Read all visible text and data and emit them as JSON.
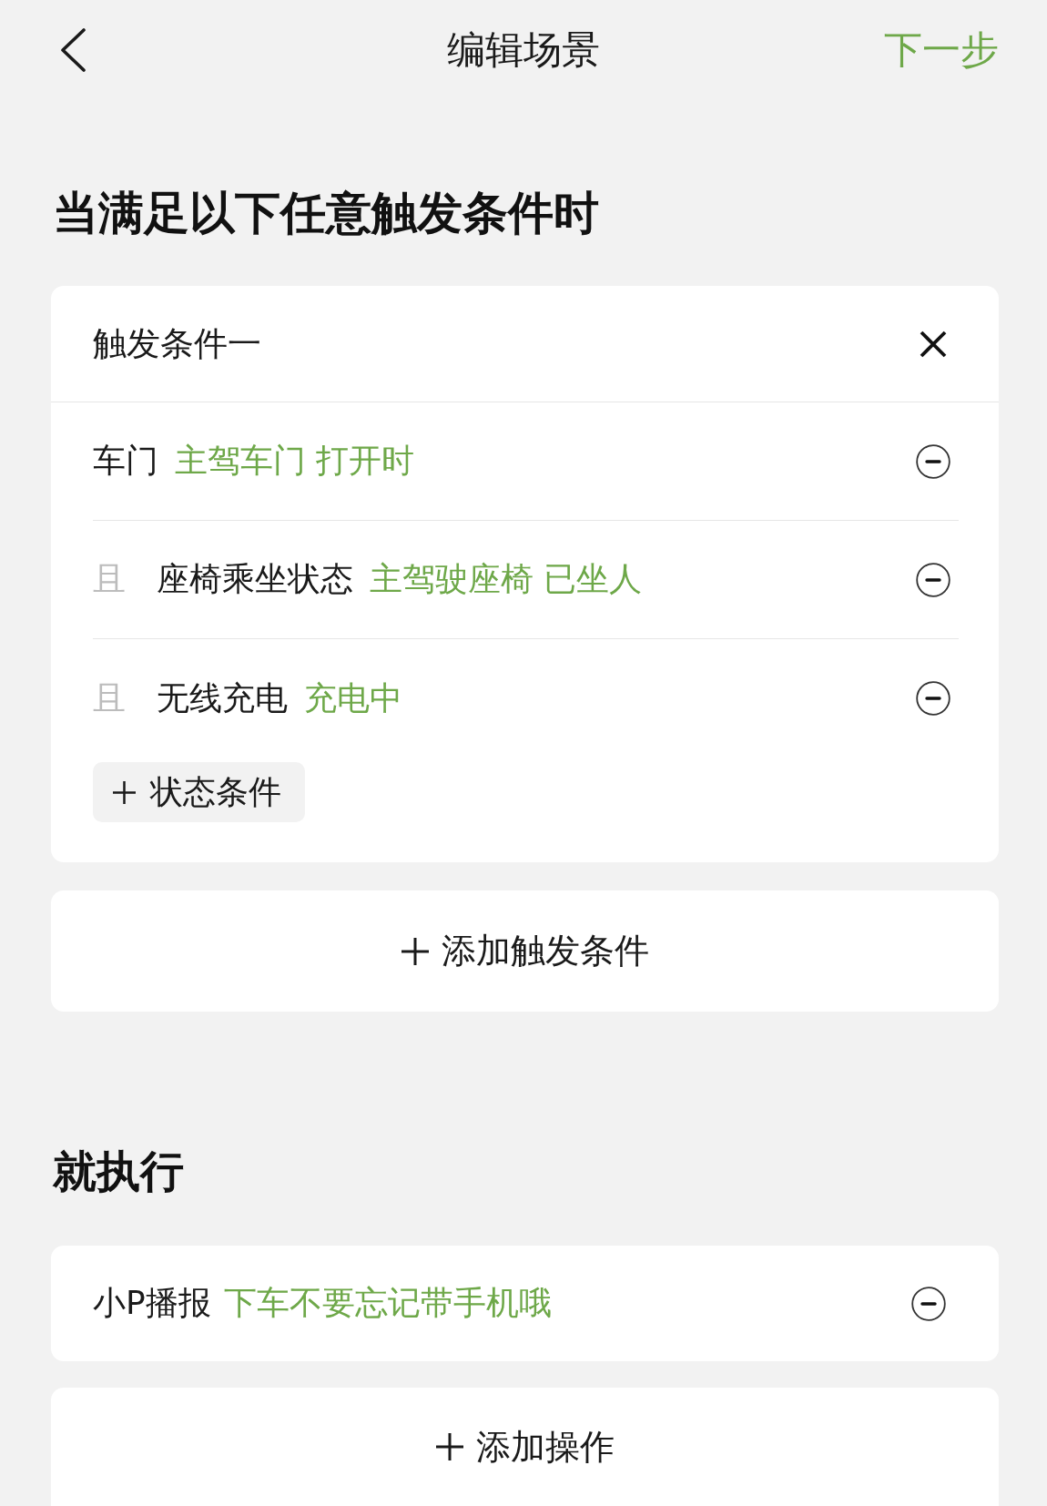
{
  "nav": {
    "title": "编辑场景",
    "next": "下一步"
  },
  "trigger_section": {
    "heading": "当满足以下任意触发条件时",
    "triggers": [
      {
        "title": "触发条件一",
        "conditions": [
          {
            "name": "车门",
            "value": "主驾车门 打开时"
          },
          {
            "connector": "且",
            "name": "座椅乘坐状态",
            "value": "主驾驶座椅 已坐人"
          },
          {
            "connector": "且",
            "name": "无线充电",
            "value": "充电中"
          }
        ],
        "add_condition": "状态条件"
      }
    ],
    "add_trigger": "添加触发条件"
  },
  "action_section": {
    "heading": "就执行",
    "actions": [
      {
        "name": "小P播报",
        "value": "下车不要忘记带手机哦"
      }
    ],
    "add_action": "添加操作"
  }
}
